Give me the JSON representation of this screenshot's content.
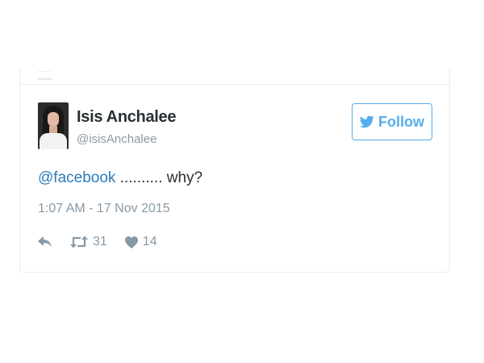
{
  "tweet": {
    "author": {
      "display_name": "Isis Anchalee",
      "screen_name": "@isisAnchalee"
    },
    "follow_button": {
      "label": "Follow",
      "icon": "bird-icon",
      "accent_color": "#55acee"
    },
    "text": {
      "mention": "@facebook",
      "rest": " .......... why?"
    },
    "timestamp": "1:07 AM - 17 Nov 2015",
    "actions": {
      "reply_icon": "reply-icon",
      "retweet_icon": "retweet-icon",
      "retweet_count": "31",
      "like_icon": "heart-icon",
      "like_count": "14"
    }
  }
}
